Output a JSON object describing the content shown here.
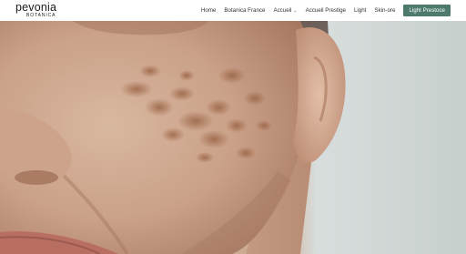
{
  "brand": {
    "name": "pevonia",
    "tagline": "BOTANICA"
  },
  "nav": {
    "items": [
      {
        "label": "Home"
      },
      {
        "label": "Botanica France"
      },
      {
        "label": "Accueil",
        "has_dropdown": true
      },
      {
        "label": "Accueil Prestige"
      },
      {
        "label": "Light"
      },
      {
        "label": "Skin-ore"
      }
    ],
    "cta_label": "Light Prestoce"
  },
  "colors": {
    "accent": "#4d7a6c",
    "header_bg": "#ffffff",
    "nav_text": "#333333"
  },
  "hero": {
    "image": "close-up of a woman's cheek showing hyperpigmentation spots"
  }
}
